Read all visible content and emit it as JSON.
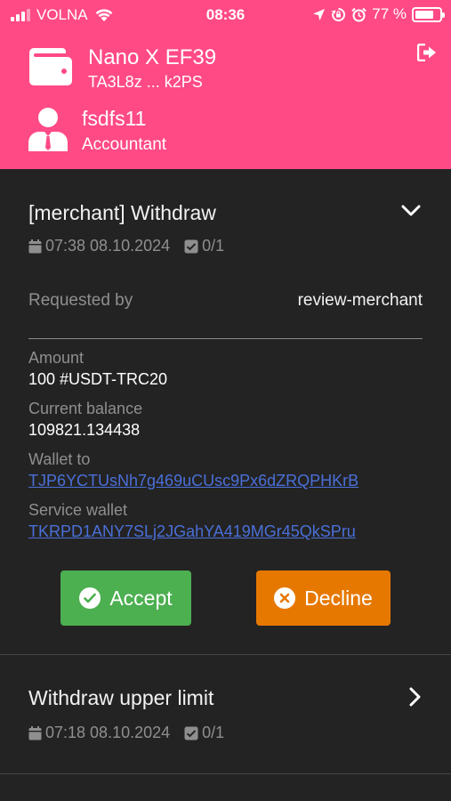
{
  "status_bar": {
    "carrier": "VOLNA",
    "time": "08:36",
    "battery_percent": "77 %",
    "battery_level": 0.77
  },
  "header": {
    "device_name": "Nano X EF39",
    "device_address": "TA3L8z ... k2PS",
    "user_name": "fsdfs11",
    "user_role": "Accountant"
  },
  "requests": [
    {
      "title": "[merchant] Withdraw",
      "datetime": "07:38 08.10.2024",
      "approvals": "0/1",
      "expanded": true,
      "requested_by_label": "Requested by",
      "requested_by_value": "review-merchant",
      "amount_label": "Amount",
      "amount_value": "100 #USDT-TRC20",
      "balance_label": "Current balance",
      "balance_value": "109821.134438",
      "wallet_to_label": "Wallet to",
      "wallet_to_value": "TJP6YCTUsNh7g469uCUsc9Px6dZRQPHKrB",
      "service_wallet_label": "Service wallet",
      "service_wallet_value": "TKRPD1ANY7SLj2JGahYA419MGr45QkSPru",
      "accept_label": "Accept",
      "decline_label": "Decline"
    },
    {
      "title": "Withdraw upper limit",
      "datetime": "07:18 08.10.2024",
      "approvals": "0/1",
      "expanded": false
    }
  ],
  "colors": {
    "brand": "#ff4a86",
    "background": "#232323",
    "accept": "#4caf50",
    "decline": "#e67800",
    "link": "#4a6fd8"
  }
}
